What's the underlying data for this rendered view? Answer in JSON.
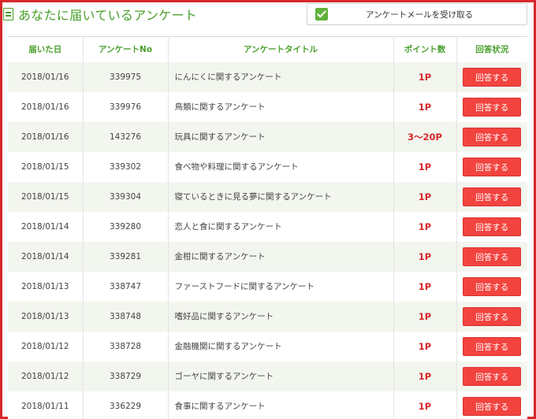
{
  "header": {
    "title": "あなたに届いているアンケート",
    "mail_checkbox_label": "アンケートメールを受け取る"
  },
  "table": {
    "columns": [
      "届いた日",
      "アンケートNo",
      "アンケートタイトル",
      "ポイント数",
      "回答状況"
    ],
    "rows": [
      {
        "date": "2018/01/16",
        "no": "339975",
        "title": "にんにくに関するアンケート",
        "points": "1P",
        "action": "回答する"
      },
      {
        "date": "2018/01/16",
        "no": "339976",
        "title": "鳥類に関するアンケート",
        "points": "1P",
        "action": "回答する"
      },
      {
        "date": "2018/01/16",
        "no": "143276",
        "title": "玩具に関するアンケート",
        "points": "3～20P",
        "action": "回答する"
      },
      {
        "date": "2018/01/15",
        "no": "339302",
        "title": "食べ物や料理に関するアンケート",
        "points": "1P",
        "action": "回答する"
      },
      {
        "date": "2018/01/15",
        "no": "339304",
        "title": "寝ているときに見る夢に関するアンケート",
        "points": "1P",
        "action": "回答する"
      },
      {
        "date": "2018/01/14",
        "no": "339280",
        "title": "恋人と食に関するアンケート",
        "points": "1P",
        "action": "回答する"
      },
      {
        "date": "2018/01/14",
        "no": "339281",
        "title": "金柑に関するアンケート",
        "points": "1P",
        "action": "回答する"
      },
      {
        "date": "2018/01/13",
        "no": "338747",
        "title": "ファーストフードに関するアンケート",
        "points": "1P",
        "action": "回答する"
      },
      {
        "date": "2018/01/13",
        "no": "338748",
        "title": "嗜好品に関するアンケート",
        "points": "1P",
        "action": "回答する"
      },
      {
        "date": "2018/01/12",
        "no": "338728",
        "title": "金融機関に関するアンケート",
        "points": "1P",
        "action": "回答する"
      },
      {
        "date": "2018/01/12",
        "no": "338729",
        "title": "ゴーヤに関するアンケート",
        "points": "1P",
        "action": "回答する"
      },
      {
        "date": "2018/01/11",
        "no": "336229",
        "title": "食事に関するアンケート",
        "points": "1P",
        "action": "回答する"
      }
    ]
  },
  "colors": {
    "accent_green": "#4aa02c",
    "highlight_red": "#d8282b",
    "button_red": "#f2433f",
    "row_stripe": "#f2f6ee"
  }
}
